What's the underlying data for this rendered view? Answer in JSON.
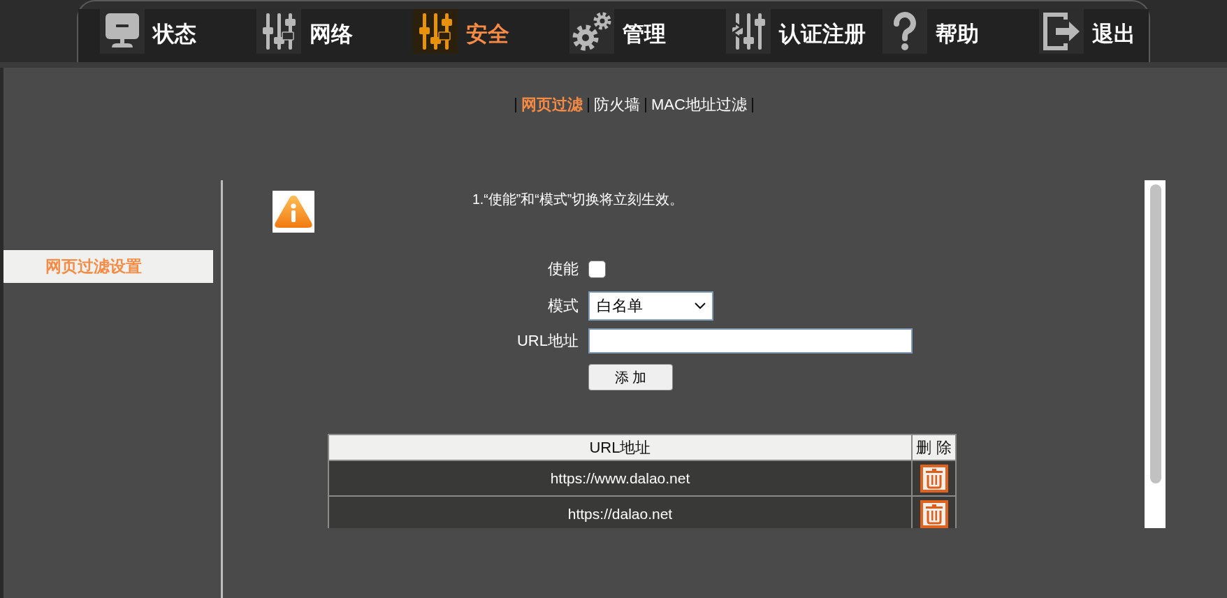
{
  "nav": {
    "items": [
      {
        "label": "状态",
        "selected": false
      },
      {
        "label": "网络",
        "selected": false
      },
      {
        "label": "安全",
        "selected": true
      },
      {
        "label": "管理",
        "selected": false
      },
      {
        "label": "认证注册",
        "selected": false
      },
      {
        "label": "帮助",
        "selected": false
      },
      {
        "label": "退出",
        "selected": false
      }
    ]
  },
  "subtabs": [
    {
      "label": "网页过滤",
      "selected": true
    },
    {
      "label": "防火墙",
      "selected": false
    },
    {
      "label": "MAC地址过滤",
      "selected": false
    }
  ],
  "sidebar": {
    "items": [
      {
        "label": "网页过滤设置",
        "selected": true
      }
    ]
  },
  "notice": {
    "text": "1.“使能”和“模式”切换将立刻生效。"
  },
  "form": {
    "fields": [
      {
        "kind": "checkbox",
        "label": "使能",
        "checked": false
      },
      {
        "kind": "select",
        "label": "模式",
        "value": "白名单"
      },
      {
        "kind": "text",
        "label": "URL地址"
      }
    ],
    "add_button": {
      "label": "添 加"
    }
  },
  "table": {
    "columns": [
      "URL地址",
      "删 除"
    ],
    "rows": [
      {
        "url": "https://www.dalao.net"
      },
      {
        "url": "https://dalao.net"
      }
    ]
  }
}
